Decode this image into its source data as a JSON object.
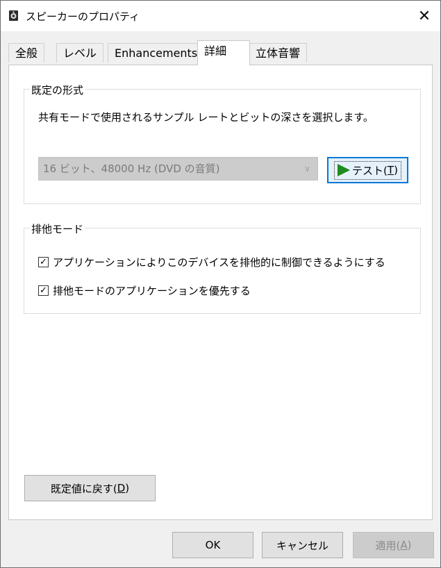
{
  "window": {
    "title": "スピーカーのプロパティ",
    "close_glyph": "✕"
  },
  "tabs": [
    {
      "label": "全般",
      "active": false
    },
    {
      "label": "レベル",
      "active": false
    },
    {
      "label": "Enhancements",
      "active": false
    },
    {
      "label": "詳細",
      "active": true
    },
    {
      "label": "立体音響",
      "active": false
    }
  ],
  "default_format": {
    "group_label": "既定の形式",
    "description": "共有モードで使用されるサンプル レートとビットの深さを選択します。",
    "selected_value": "16 ビット、48000 Hz (DVD の音質)",
    "test_label": "テスト(",
    "test_accel": "T",
    "test_suffix": ")"
  },
  "exclusive_mode": {
    "group_label": "排他モード",
    "options": [
      {
        "label": "アプリケーションによりこのデバイスを排他的に制御できるようにする",
        "checked": true
      },
      {
        "label": "排他モードのアプリケーションを優先する",
        "checked": true
      }
    ]
  },
  "restore": {
    "prefix": "既定値に戻す(",
    "accel": "D",
    "suffix": ")"
  },
  "footer": {
    "ok": "OK",
    "cancel": "キャンセル",
    "apply_prefix": "適用(",
    "apply_accel": "A",
    "apply_suffix": ")"
  },
  "colors": {
    "accent": "#0078d7",
    "play_green": "#1e8c1e"
  },
  "icons": {
    "title": "speaker-icon",
    "test": "play-icon",
    "check": "checkmark-icon"
  }
}
